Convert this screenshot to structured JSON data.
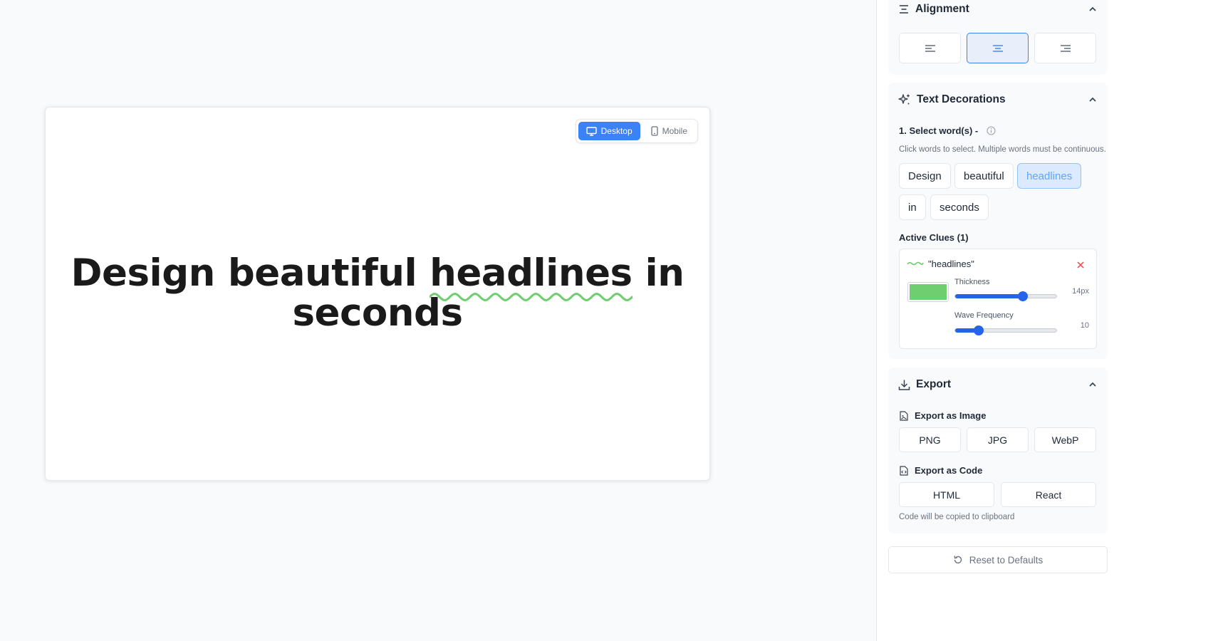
{
  "preview": {
    "device_toggle": {
      "desktop_label": "Desktop",
      "mobile_label": "Mobile",
      "active": "desktop"
    },
    "headline_words": [
      "Design",
      "beautiful",
      "headlines",
      "in",
      "seconds"
    ],
    "decorated_word_index": 2,
    "text_color": "#1a1a1a",
    "decoration_color": "#6fce6f"
  },
  "alignment": {
    "title": "Alignment",
    "options": [
      "align-left-icon",
      "align-center-icon",
      "align-right-icon"
    ],
    "active": "center"
  },
  "text_decorations": {
    "title": "Text Decorations",
    "select_label": "1. Select word(s) -",
    "hint": "Click words to select. Multiple words must be continuous.",
    "words": [
      "Design",
      "beautiful",
      "headlines",
      "in",
      "seconds"
    ],
    "selected_index": 2,
    "active_clues_label": "Active Clues (1)",
    "clue": {
      "word": "\"headlines\"",
      "color": "#6fce6f",
      "thickness_label": "Thickness",
      "thickness_value": "14px",
      "thickness_fraction": 0.67,
      "wave_label": "Wave Frequency",
      "wave_value": "10",
      "wave_fraction": 0.23
    }
  },
  "export": {
    "title": "Export",
    "image_label": "Export as Image",
    "image_formats": [
      "PNG",
      "JPG",
      "WebP"
    ],
    "code_label": "Export as Code",
    "code_formats": [
      "HTML",
      "React"
    ],
    "code_hint": "Code will be copied to clipboard"
  },
  "reset_label": "Reset to Defaults",
  "accent_color": "#3b82f6"
}
